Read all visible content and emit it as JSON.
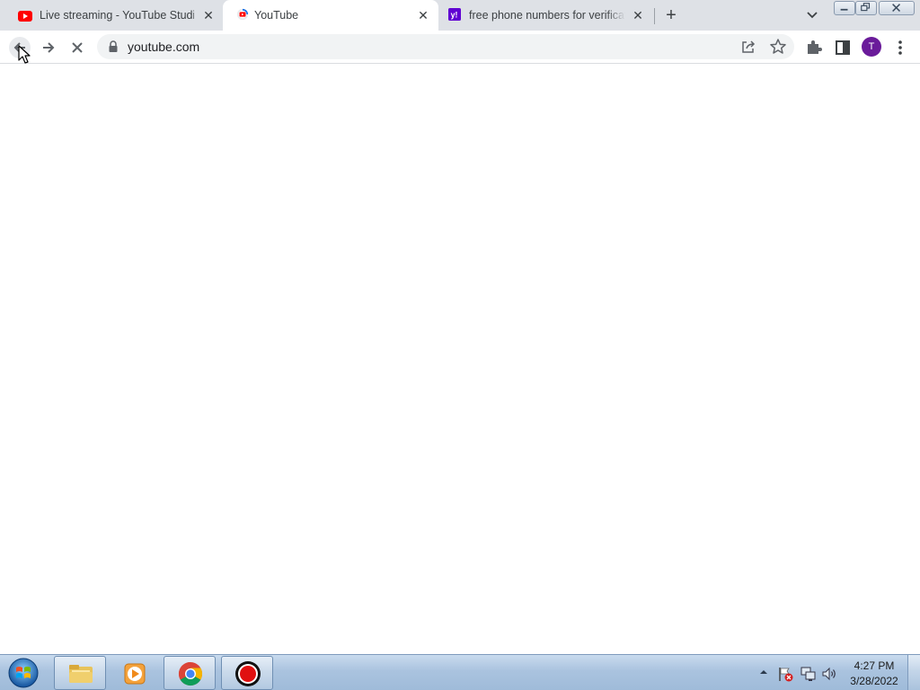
{
  "browser": {
    "tabs": [
      {
        "title": "Live streaming - YouTube Studio",
        "favicon": "youtube-icon",
        "active": false
      },
      {
        "title": "YouTube",
        "favicon": "youtube-loading-icon",
        "active": true
      },
      {
        "title": "free phone numbers for verification",
        "favicon": "yahoo-icon",
        "active": false
      }
    ],
    "new_tab_label": "+",
    "close_label": "✕"
  },
  "toolbar": {
    "url": "youtube.com",
    "profile_initial": "T",
    "loading": true
  },
  "taskbar": {
    "apps": [
      {
        "name": "Windows Explorer",
        "icon": "folder-icon"
      },
      {
        "name": "Windows Media Player",
        "icon": "media-player-icon"
      },
      {
        "name": "Google Chrome",
        "icon": "chrome-icon"
      },
      {
        "name": "Screen Recorder",
        "icon": "record-icon"
      }
    ],
    "clock": {
      "time": "4:27 PM",
      "date": "3/28/2022"
    }
  },
  "colors": {
    "tabstrip_bg": "#dee1e6",
    "omnibox_bg": "#f1f3f4",
    "avatar_bg": "#6a1b9a",
    "youtube_red": "#ff0000",
    "yahoo_purple": "#6001d2"
  }
}
